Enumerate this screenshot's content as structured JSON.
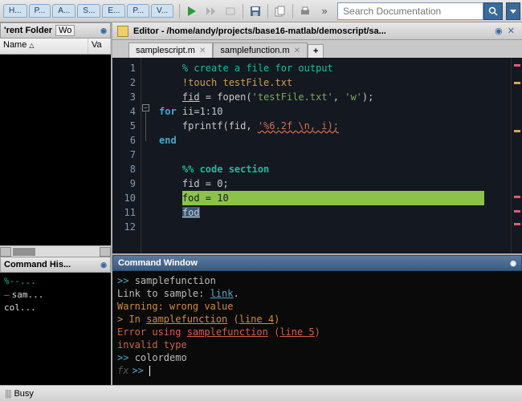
{
  "toolbar": {
    "tabs": [
      "H...",
      "P...",
      "A...",
      "S...",
      "E...",
      "P...",
      "V..."
    ],
    "search_placeholder": "Search Documentation"
  },
  "folder_panel": {
    "title": "'rent Folder",
    "other_tab": "Wo",
    "cols": [
      "Name",
      "Va"
    ]
  },
  "cmd_history": {
    "title": "Command His...",
    "items": [
      {
        "text": "%--...",
        "kind": "comment"
      },
      {
        "text": "sam...",
        "kind": "marked"
      },
      {
        "text": "col...",
        "kind": "plain"
      }
    ]
  },
  "editor": {
    "bar_title": "Editor - /home/andy/projects/base16-matlab/demoscript/sa...",
    "tabs": [
      {
        "label": "samplescript.m",
        "active": true
      },
      {
        "label": "samplefunction.m",
        "active": false
      }
    ],
    "lines": [
      {
        "n": 1,
        "seg": [
          {
            "t": "    ",
            "c": ""
          },
          {
            "t": "% create a file for output",
            "c": "cmt2"
          }
        ]
      },
      {
        "n": 2,
        "seg": [
          {
            "t": "    ",
            "c": ""
          },
          {
            "t": "!touch testFile.txt",
            "c": "bang"
          }
        ]
      },
      {
        "n": 3,
        "seg": [
          {
            "t": "    ",
            "c": ""
          },
          {
            "t": "fid",
            "c": "ul"
          },
          {
            "t": " = fopen(",
            "c": ""
          },
          {
            "t": "'testFile.txt'",
            "c": "str"
          },
          {
            "t": ", ",
            "c": ""
          },
          {
            "t": "'w'",
            "c": "str"
          },
          {
            "t": ");",
            "c": ""
          }
        ]
      },
      {
        "n": 4,
        "seg": [
          {
            "t": "for",
            "c": "kw"
          },
          {
            "t": " ii=1:10",
            "c": ""
          }
        ]
      },
      {
        "n": 5,
        "seg": [
          {
            "t": "    fprintf(fid, ",
            "c": ""
          },
          {
            "t": "'%6.2f \\n, i);",
            "c": "err"
          }
        ]
      },
      {
        "n": 6,
        "seg": [
          {
            "t": "end",
            "c": "kw"
          }
        ]
      },
      {
        "n": 7,
        "seg": []
      },
      {
        "n": 8,
        "seg": [
          {
            "t": "    ",
            "c": ""
          },
          {
            "t": "%% code section",
            "c": "section"
          }
        ]
      },
      {
        "n": 9,
        "seg": [
          {
            "t": "    fid = 0;",
            "c": ""
          }
        ]
      },
      {
        "n": 10,
        "seg": [
          {
            "t": "    ",
            "c": ""
          },
          {
            "t": "fod = 10                                            ",
            "c": "hl"
          }
        ]
      },
      {
        "n": 11,
        "seg": [
          {
            "t": "    ",
            "c": ""
          },
          {
            "t": "fod",
            "c": "sel ul"
          }
        ]
      },
      {
        "n": 12,
        "seg": []
      }
    ]
  },
  "cmd_window": {
    "title": "Command Window",
    "lines": [
      {
        "seg": [
          {
            "t": ">> ",
            "c": "pr"
          },
          {
            "t": "samplefunction",
            "c": ""
          }
        ]
      },
      {
        "seg": [
          {
            "t": "Link to sample: ",
            "c": ""
          },
          {
            "t": "link",
            "c": "lnk"
          },
          {
            "t": ".",
            "c": ""
          }
        ]
      },
      {
        "seg": [
          {
            "t": "Warning: wrong value",
            "c": "wrn"
          }
        ]
      },
      {
        "seg": [
          {
            "t": "> In ",
            "c": "wrn"
          },
          {
            "t": "samplefunction",
            "c": "wrn eru"
          },
          {
            "t": " (",
            "c": "wrn"
          },
          {
            "t": "line 4",
            "c": "wrn eru"
          },
          {
            "t": ")",
            "c": "wrn"
          }
        ]
      },
      {
        "seg": [
          {
            "t": "Error using ",
            "c": "er2"
          },
          {
            "t": "samplefunction",
            "c": "er2 eru"
          },
          {
            "t": " (",
            "c": "er2"
          },
          {
            "t": "line 5",
            "c": "er2 eru"
          },
          {
            "t": ")",
            "c": "er2"
          }
        ]
      },
      {
        "seg": [
          {
            "t": "invalid type",
            "c": "er2"
          }
        ]
      },
      {
        "seg": [
          {
            "t": ">> ",
            "c": "pr"
          },
          {
            "t": "colordemo",
            "c": ""
          }
        ]
      }
    ],
    "prompt": ">> "
  },
  "status": {
    "text": "Busy"
  },
  "colors": {
    "mark_err": "#e05a7a",
    "mark_warn": "#e0a04a",
    "mark_ok": "#a0e05a"
  }
}
